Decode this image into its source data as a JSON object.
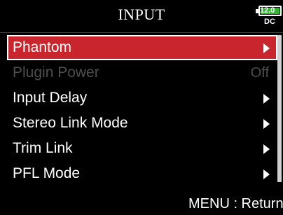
{
  "header": {
    "title": "INPUT"
  },
  "battery": {
    "voltage": "12.0",
    "source": "DC",
    "color": "#33b533"
  },
  "menu": {
    "items": [
      {
        "label": "Phantom",
        "value": "",
        "selected": true,
        "enabled": true,
        "has_submenu": true
      },
      {
        "label": "Plugin Power",
        "value": "Off",
        "selected": false,
        "enabled": false,
        "has_submenu": false
      },
      {
        "label": "Input Delay",
        "value": "",
        "selected": false,
        "enabled": true,
        "has_submenu": true
      },
      {
        "label": "Stereo Link Mode",
        "value": "",
        "selected": false,
        "enabled": true,
        "has_submenu": true
      },
      {
        "label": "Trim Link",
        "value": "",
        "selected": false,
        "enabled": true,
        "has_submenu": true
      },
      {
        "label": "PFL Mode",
        "value": "",
        "selected": false,
        "enabled": true,
        "has_submenu": true
      }
    ]
  },
  "scroll": {
    "thumb_start": 0.0,
    "thumb_fraction": 1.0
  },
  "footer": {
    "hint": "MENU : Return"
  },
  "colors": {
    "selection": "#c8262c",
    "disabled_text": "#4d4d4d",
    "background": "#000000"
  }
}
